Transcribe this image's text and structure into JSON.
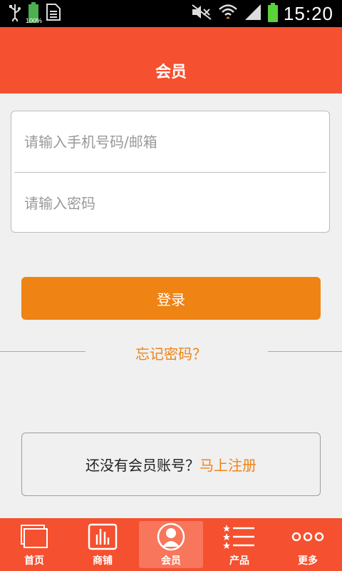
{
  "status_bar": {
    "time": "15:20",
    "battery_left_label": "100%",
    "icons": [
      "usb-icon",
      "battery-icon",
      "sim-icon",
      "mute-icon",
      "wifi-icon",
      "signal-icon",
      "battery-icon"
    ]
  },
  "header": {
    "title": "会员"
  },
  "login": {
    "account_placeholder": "请输入手机号码/邮箱",
    "password_placeholder": "请输入密码",
    "submit_label": "登录",
    "forgot_label": "忘记密码？"
  },
  "register": {
    "prompt": "还没有会员账号？",
    "link": "马上注册"
  },
  "tabbar": {
    "items": [
      {
        "label": "首页",
        "icon": "home-icon"
      },
      {
        "label": "商铺",
        "icon": "shop-icon"
      },
      {
        "label": "会员",
        "icon": "member-icon",
        "active": true
      },
      {
        "label": "产品",
        "icon": "products-icon"
      },
      {
        "label": "更多",
        "icon": "more-icon"
      }
    ]
  },
  "colors": {
    "accent": "#f5502f",
    "button": "#ef8313",
    "link": "#ef8313"
  }
}
